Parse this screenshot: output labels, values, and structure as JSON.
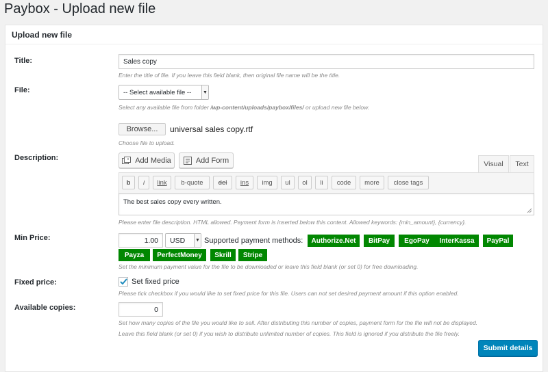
{
  "page_title": "Paybox - Upload new file",
  "card_title": "Upload new file",
  "title_field": {
    "label": "Title:",
    "value": "Sales copy",
    "hint": "Enter the title of file. If you leave this field blank, then original file name will be the title."
  },
  "file_field": {
    "label": "File:",
    "select_value": "-- Select available file --",
    "hint_prefix": "Select any available file from folder ",
    "hint_path": "/wp-content/uploads/paybox/files/",
    "hint_suffix": " or upload new file below.",
    "browse_label": "Browse...",
    "chosen_file": "universal sales copy.rtf",
    "upload_hint": "Choose file to upload."
  },
  "description_field": {
    "label": "Description:",
    "add_media_label": "Add Media",
    "add_form_label": "Add Form",
    "tab_visual": "Visual",
    "tab_text": "Text",
    "quicktags": [
      "b",
      "i",
      "link",
      "b-quote",
      "del",
      "ins",
      "img",
      "ul",
      "ol",
      "li",
      "code",
      "more",
      "close tags"
    ],
    "content": "The best sales copy every written.",
    "hint": "Please enter file description. HTML allowed. Payment form is inserted below this content. Allowed keywords: {min_amount}, {currency}."
  },
  "min_price_field": {
    "label": "Min Price:",
    "value": "1.00",
    "currency": "USD",
    "methods_label": "Supported payment methods:",
    "methods": [
      "Authorize.Net",
      "BitPay",
      "EgoPay",
      "InterKassa",
      "PayPal",
      "Payza",
      "PerfectMoney",
      "Skrill",
      "Stripe"
    ],
    "method_color": "#018701",
    "hint": "Set the minimum payment value for the file to be downloaded or leave this field blank (or set 0) for free downloading."
  },
  "fixed_price_field": {
    "label": "Fixed price:",
    "checkbox_label": "Set fixed price",
    "checked": true,
    "hint": "Please tick checkbox if you would like to set fixed price for this file. Users can not set desired payment amount if this option enabled."
  },
  "copies_field": {
    "label": "Available copies:",
    "value": "0",
    "hint_line1": "Set how many copies of the file you would like to sell. After distributing this number of copies, payment form for the file will not be displayed.",
    "hint_line2": "Leave this field blank (or set 0) if you wish to distribute unlimited number of copies. This field is ignored if you distribute the file freely."
  },
  "submit_label": "Submit details",
  "accent_color": "#0085ba"
}
